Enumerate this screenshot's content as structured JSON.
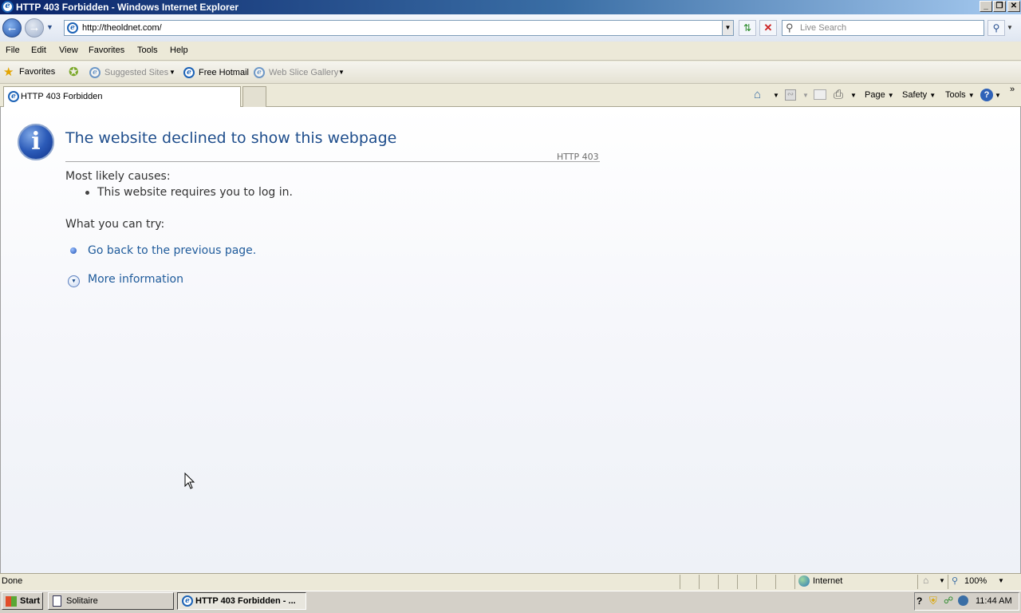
{
  "window": {
    "title": "HTTP 403 Forbidden - Windows Internet Explorer",
    "min": "_",
    "max": "❐",
    "close": "✕"
  },
  "address": {
    "url": "http://theoldnet.com/"
  },
  "search": {
    "placeholder": "Live Search"
  },
  "menu": [
    "File",
    "Edit",
    "View",
    "Favorites",
    "Tools",
    "Help"
  ],
  "favorites": {
    "label": "Favorites",
    "suggested": "Suggested Sites",
    "hotmail": "Free Hotmail",
    "webslice": "Web Slice Gallery"
  },
  "tab": {
    "title": "HTTP 403 Forbidden"
  },
  "commandbar": {
    "page": "Page",
    "safety": "Safety",
    "tools": "Tools"
  },
  "page": {
    "heading": "The website declined to show this webpage",
    "code": "HTTP 403",
    "causes_label": "Most likely causes:",
    "cause_1": "This website requires you to log in.",
    "try_label": "What you can try:",
    "go_back": "Go back to the previous page.",
    "more_info": "More information"
  },
  "status": {
    "text": "Done",
    "zone": "Internet",
    "zoom": "100%"
  },
  "taskbar": {
    "start": "Start",
    "solitaire": "Solitaire",
    "ie": "HTTP 403 Forbidden - ...",
    "time": "11:44 AM"
  },
  "icons": [
    "ie-icon",
    "back-arrow-icon",
    "forward-arrow-icon",
    "refresh-icon",
    "stop-icon",
    "search-icon",
    "star-icon",
    "home-icon",
    "feeds-icon",
    "print-icon",
    "help-icon",
    "info-icon",
    "bullet-icon",
    "expand-icon",
    "globe-icon",
    "zoom-icon",
    "windows-flag-icon"
  ],
  "colors": {
    "heading": "#1f4e8c",
    "link": "#1f5b9b",
    "titlebar": "#0a246a"
  }
}
